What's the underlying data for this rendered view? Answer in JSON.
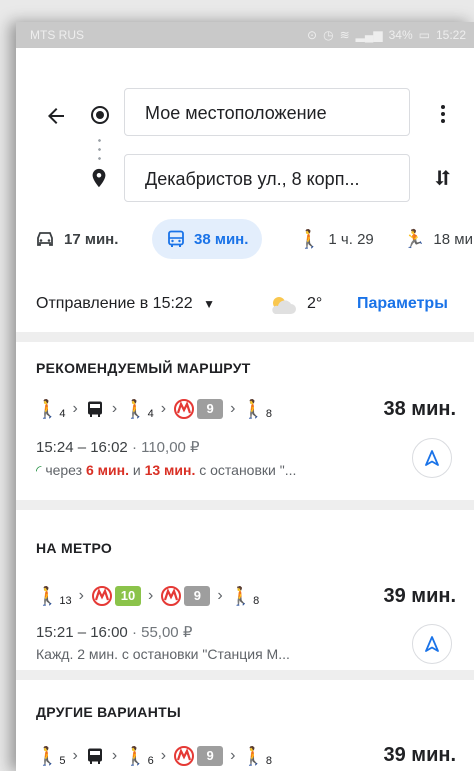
{
  "status_bar": {
    "carrier": "MTS RUS",
    "battery": "34%",
    "time": "15:22"
  },
  "search": {
    "origin": "Мое местоположение",
    "destination": "Декабристов ул., 8 корп..."
  },
  "modes": [
    {
      "name": "car",
      "time": "17 мин."
    },
    {
      "name": "transit",
      "time": "38 мин."
    },
    {
      "name": "walk",
      "time": "1 ч. 29"
    },
    {
      "name": "ride",
      "time": "18 ми"
    }
  ],
  "departure": {
    "label": "Отправление в 15:22",
    "temperature": "2°",
    "params_link": "Параметры"
  },
  "cards": [
    {
      "title": "РЕКОМЕНДУЕМЫЙ МАРШРУТ",
      "walk1": "4",
      "walk2": "4",
      "line": "9",
      "walk3": "8",
      "duration": "38 мин.",
      "times": "15:24 – 16:02",
      "price": "110,00 ₽",
      "note_prefix": "через",
      "note_t1": "6 мин.",
      "note_mid": "и",
      "note_t2": "13 мин.",
      "note_suffix": "с остановки \"..."
    },
    {
      "title": "НА МЕТРО",
      "walk1": "13",
      "line1": "10",
      "line2": "9",
      "walk2": "8",
      "duration": "39 мин.",
      "times": "15:21 – 16:00",
      "price": "55,00 ₽",
      "note": "Кажд. 2 мин. с остановки \"Станция М..."
    },
    {
      "title": "ДРУГИЕ ВАРИАНТЫ",
      "walk1": "5",
      "walk2": "6",
      "line": "9",
      "walk3": "8",
      "duration": "39 мин."
    }
  ],
  "colors": {
    "accent": "#1a73e8",
    "line9": "#9e9e9e",
    "line10": "#8bc34a",
    "metro": "#e53935",
    "delay": "#d93025"
  }
}
